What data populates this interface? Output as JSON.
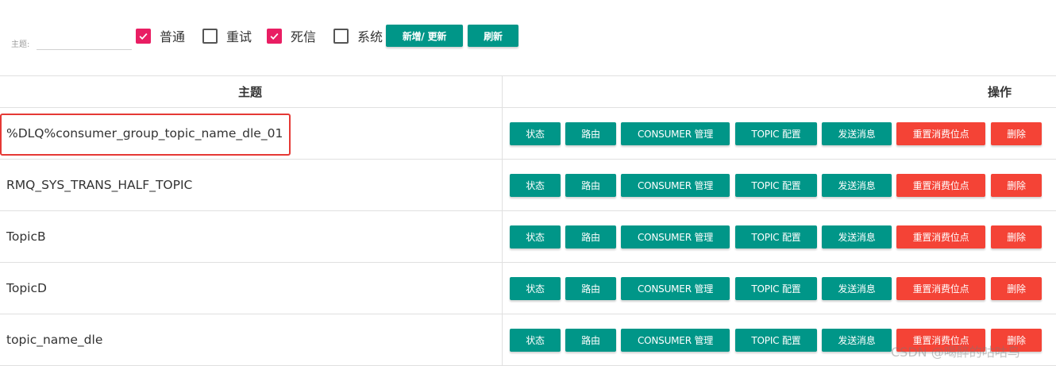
{
  "filter": {
    "topic_label": "主题:",
    "topic_value": "",
    "checkboxes": [
      {
        "label": "普通",
        "checked": true
      },
      {
        "label": "重试",
        "checked": false
      },
      {
        "label": "死信",
        "checked": true
      },
      {
        "label": "系统",
        "checked": false
      }
    ],
    "add_update_label": "新增/ 更新",
    "refresh_label": "刷新"
  },
  "table": {
    "headers": {
      "topic": "主题",
      "operation": "操作"
    },
    "rows": [
      {
        "topic": "%DLQ%consumer_group_topic_name_dle_01"
      },
      {
        "topic": "RMQ_SYS_TRANS_HALF_TOPIC"
      },
      {
        "topic": "TopicB"
      },
      {
        "topic": "TopicD"
      },
      {
        "topic": "topic_name_dle"
      }
    ],
    "actions": {
      "status": "状态",
      "route": "路由",
      "consumer": "CONSUMER 管理",
      "topic_config": "TOPIC 配置",
      "send": "发送消息",
      "reset": "重置消费位点",
      "delete": "删除"
    }
  },
  "colors": {
    "teal": "#009688",
    "red": "#f44336",
    "pink_check": "#e91e63",
    "highlight": "#e53935"
  },
  "watermark": "CSDN @喝醉的咕咕鸟"
}
